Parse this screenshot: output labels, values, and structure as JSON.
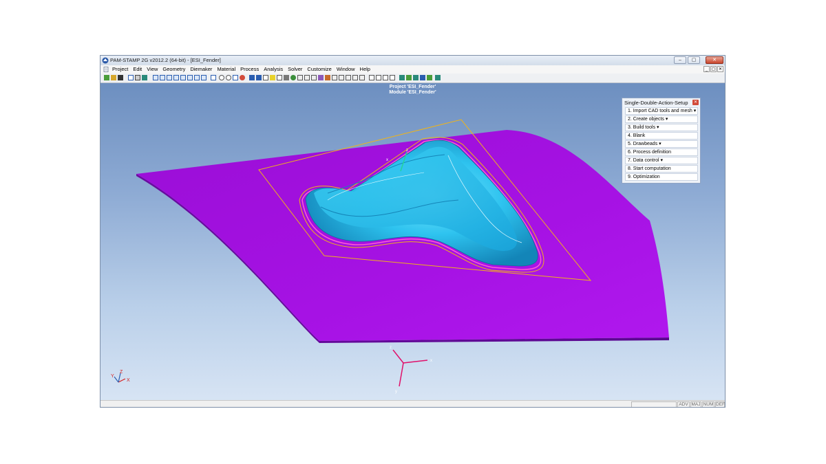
{
  "window": {
    "title": "PAM-STAMP 2G v2012.2 (64-bit) - [ESI_Fender]",
    "controls": [
      "–",
      "▢",
      "✕"
    ],
    "mdi_controls": [
      "_",
      "▢",
      "✕"
    ]
  },
  "menubar": {
    "items": [
      "Project",
      "Edit",
      "View",
      "Geometry",
      "Diemaker",
      "Material",
      "Process",
      "Analysis",
      "Solver",
      "Customize",
      "Window",
      "Help"
    ]
  },
  "viewport": {
    "project_label": "Project 'ESI_Fender'",
    "module_label": "Module 'ESI_Fender'",
    "axis_center": {
      "x": "x",
      "z": "z",
      "y": "y"
    },
    "axis_corner": {
      "x": "X",
      "y": "Y",
      "z": "Z"
    },
    "local_axis": {
      "z": "z",
      "x": "x"
    }
  },
  "panel": {
    "title": "Single-Double-Action-Setup",
    "close": "✕",
    "items": [
      "1. Import CAD tools and mesh ▾",
      "2. Create objects ▾",
      "3. Build tools ▾",
      "4. Blank",
      "5. Drawbeads ▾",
      "6. Process definition",
      "7. Data control ▾",
      "8. Start computation",
      "9. Optimization"
    ]
  },
  "statusbar": {
    "cells": [
      "",
      "ADV",
      "MAJ",
      "NUM",
      "DEF"
    ]
  },
  "colors": {
    "blank_sheet": "#a10fe0",
    "die_part": "#2ec3ef",
    "outline_yellow": "#f0b418",
    "axis_red": "#e0106a",
    "axis_x_red": "#d32020"
  }
}
